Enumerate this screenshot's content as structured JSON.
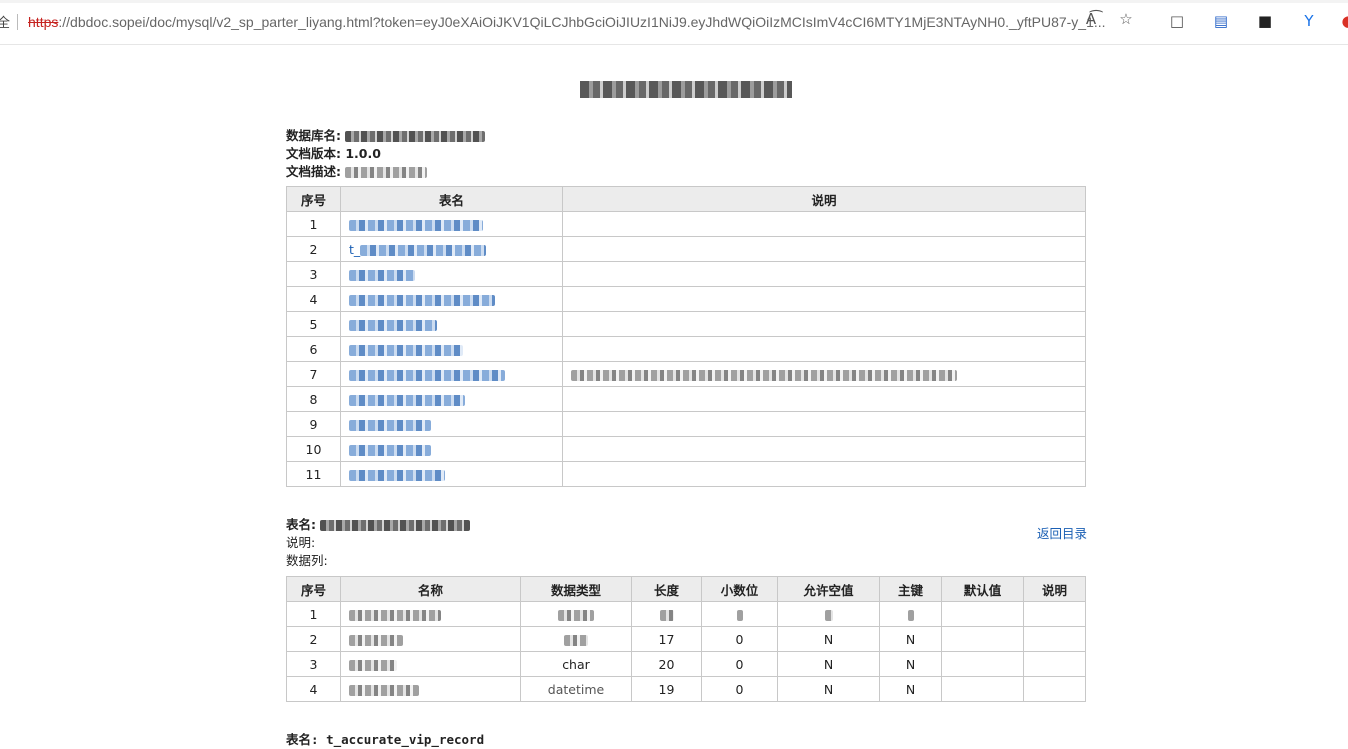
{
  "browser": {
    "url_scheme": "https",
    "url_rest": "://dbdoc.sopei/doc/mysql/v2_sp_parter_liyang.html?token=eyJ0eXAiOiJKV1QiLCJhbGciOiJIUzI1NiJ9.eyJhdWQiOiIzMCIsImV4cCI6MTY1MjE3NTAyNH0._yftPU87-y_1...",
    "lock_text": "全"
  },
  "doc": {
    "db_label": "数据库名:",
    "version_label": "文档版本:",
    "version_value": "1.0.0",
    "desc_label": "文档描述:"
  },
  "index_table": {
    "headers": [
      "序号",
      "表名",
      "说明"
    ],
    "rows": [
      "1",
      "2",
      "3",
      "4",
      "5",
      "6",
      "7",
      "8",
      "9",
      "10",
      "11"
    ],
    "row2_prefix": "t_"
  },
  "table_section": {
    "name_label": "表名:",
    "desc_label": "说明:",
    "cols_label": "数据列:",
    "return_link": "返回目录",
    "headers": [
      "序号",
      "名称",
      "数据类型",
      "长度",
      "小数位",
      "允许空值",
      "主键",
      "默认值",
      "说明"
    ],
    "rows": [
      {
        "no": "1",
        "type": "",
        "len": "",
        "dec": "",
        "nullable": "",
        "pk": ""
      },
      {
        "no": "2",
        "type": "",
        "len": "17",
        "dec": "0",
        "nullable": "N",
        "pk": "N"
      },
      {
        "no": "3",
        "type": "char",
        "len": "20",
        "dec": "0",
        "nullable": "N",
        "pk": "N"
      },
      {
        "no": "4",
        "type": "datetime",
        "len": "19",
        "dec": "0",
        "nullable": "N",
        "pk": "N"
      }
    ]
  },
  "next_section": {
    "name_label": "表名:",
    "name_value": "t_accurate_vip_record"
  }
}
